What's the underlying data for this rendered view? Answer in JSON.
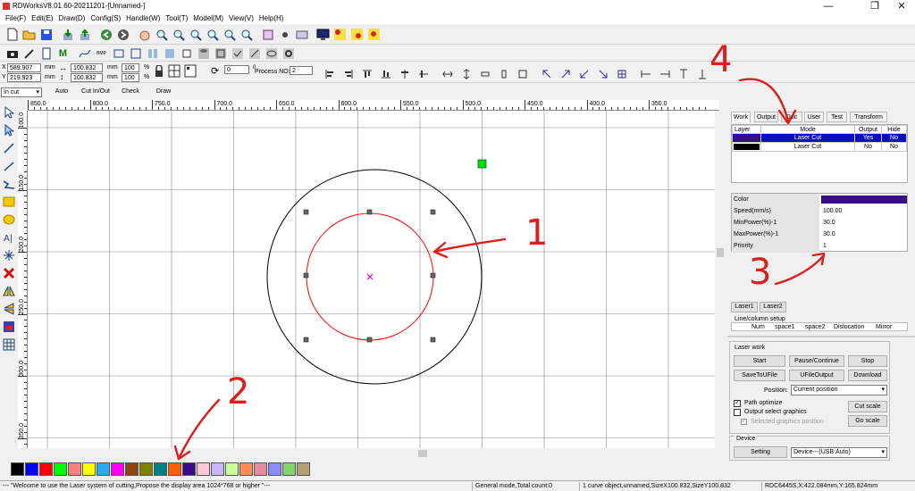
{
  "window": {
    "title": "RDWorksV8.01.60-20211201-[Unnamed-]",
    "minimize": "—",
    "restore": "❐",
    "close": "✕"
  },
  "menu": [
    "File(F)",
    "Edit(E)",
    "Draw(D)",
    "Config(S)",
    "Handle(W)",
    "Tool(T)",
    "Model(M)",
    "View(V)",
    "Help(H)"
  ],
  "coords": {
    "x_label": "X",
    "x_value": "589.907",
    "y_label": "Y",
    "y_value": "219.923",
    "unit": "mm",
    "width_value": "100.832",
    "height_value": "100.832",
    "width_unit": "mm",
    "height_unit": "mm",
    "scale_x": "100",
    "scale_y": "100",
    "pct": "%",
    "angle": "0",
    "angle_unit": "0",
    "process_label": "Process NO:",
    "process_no": "2"
  },
  "mode_bar": {
    "select_value": "In cut",
    "auto": "Auto",
    "cut_in_out": "Cut In/Out",
    "check": "Check",
    "draw": "Draw"
  },
  "ruler_top": [
    "850.0",
    "800.0",
    "750.0",
    "700.0",
    "650.0",
    "600.0",
    "550.0",
    "500.0",
    "450.0",
    "400.0",
    "350.0"
  ],
  "ruler_left": [
    "100.0",
    "150.0",
    "200.0",
    "250.0",
    "300.0",
    "350.0"
  ],
  "tabs": [
    "Work",
    "Output",
    "Doc",
    "User",
    "Test",
    "Transform"
  ],
  "layer_table": {
    "headers": [
      "Layer",
      "Mode",
      "Output",
      "Hide"
    ],
    "rows": [
      {
        "color": "#3b0a86",
        "mode": "Laser Cut",
        "output": "Yes",
        "hide": "No"
      },
      {
        "color": "#000000",
        "mode": "Laser Cut",
        "output": "No",
        "hide": "No"
      }
    ]
  },
  "params": [
    {
      "label": "Color",
      "value": ""
    },
    {
      "label": "Speed(mm/s)",
      "value": "100.00"
    },
    {
      "label": "MinPower(%)-1",
      "value": "30.0"
    },
    {
      "label": "MaxPower(%)-1",
      "value": "30.0"
    },
    {
      "label": "Priority",
      "value": "1"
    }
  ],
  "param_color": "#3b0a86",
  "laser_tabs": [
    "Laser1",
    "Laser2"
  ],
  "line_setup": {
    "title": "Line/column setup",
    "headers": [
      "Num",
      "space1",
      "space2",
      "Dislocation",
      "Mirror"
    ]
  },
  "laser_work": {
    "title": "Laser work",
    "start": "Start",
    "pause": "Pause/Continue",
    "stop": "Stop",
    "save_u": "SaveToUFile",
    "ufile_output": "UFileOutput",
    "download": "Download",
    "position_label": "Position:",
    "position_value": "Current position",
    "path_optimize": "Path optimize",
    "output_select": "Output select graphics",
    "selected_pos": "Selected graphics position",
    "cut_scale": "Cut scale",
    "go_scale": "Go scale"
  },
  "device": {
    "title": "Device",
    "setting": "Setting",
    "device_value": "Device---(USB:Auto)"
  },
  "palette": [
    "#000000",
    "#0000ff",
    "#ff0000",
    "#00ff00",
    "#ff7f7f",
    "#ffff00",
    "#2aa9e6",
    "#ff00ff",
    "#8b4513",
    "#808000",
    "#008080",
    "#ff6000",
    "#3b0a86",
    "#ffc8d2",
    "#c8b4ff",
    "#c8ff96",
    "#ff8c50",
    "#e68ca0",
    "#8c8cff",
    "#82d26e",
    "#b4a078"
  ],
  "status": {
    "welcome": "--- \"Welcome to use the Laser system of cutting,Propose the display area 1024*768 or higher \"---",
    "mode": "General mode,Total count:0",
    "object": "1 curve object,unnamed,SizeX100.832,SizeY100.832",
    "position": "RDC6445S,X:422.084mm,Y:165.824mm"
  },
  "annotations": [
    "1",
    "2",
    "3",
    "4"
  ],
  "colors": {
    "selection": "#000000",
    "cut_layer": "#ff0000",
    "origin_marker": "#00dd00",
    "center_mark": "#e000e0",
    "annotation": "#d8201c"
  }
}
